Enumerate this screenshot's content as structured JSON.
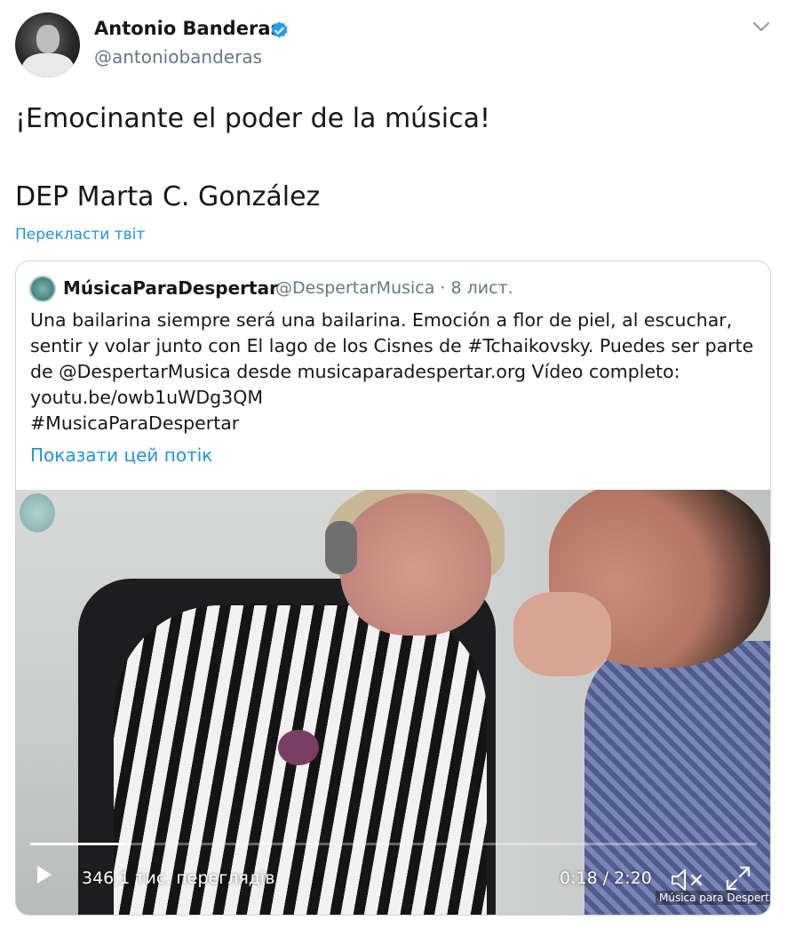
{
  "tweet": {
    "author_name": "Antonio Banderas",
    "handle": "@antoniobanderas",
    "text_lines": [
      "¡Emocinante el poder de la música!",
      "DEP Marta C. González"
    ],
    "translate_label": "Перекласти твіт",
    "icons": {
      "verified": "verified-badge-icon",
      "menu": "chevron-down-icon"
    }
  },
  "quote": {
    "author_name": "MúsicaParaDespertar",
    "meta": "@DespertarMusica · 8 лист.",
    "text_lines": [
      "Una bailarina siempre será una bailarina. Emoción a flor de piel, al escuchar,",
      "sentir y volar junto con El lago de los Cisnes de #Tchaikovsky. Puedes ser parte",
      "de @DespertarMusica desde musicaparadespertar.org Vídeo completo:",
      "youtu.be/owb1uWDg3QM",
      "#MusicaParaDespertar"
    ],
    "thread_label": "Показати цей потік",
    "video": {
      "views": "346,1 тис. переглядів",
      "time": "0:18 / 2:20",
      "progress": 0.13,
      "watermark": "Música para Despertar",
      "icons": {
        "play": "play-icon",
        "mute": "mute-icon",
        "fullscreen": "fullscreen-icon"
      }
    }
  },
  "colors": {
    "link": "#1b95e0",
    "verified": "#1da1f2",
    "secondary_text": "#657786",
    "border": "#ccd6dd"
  }
}
